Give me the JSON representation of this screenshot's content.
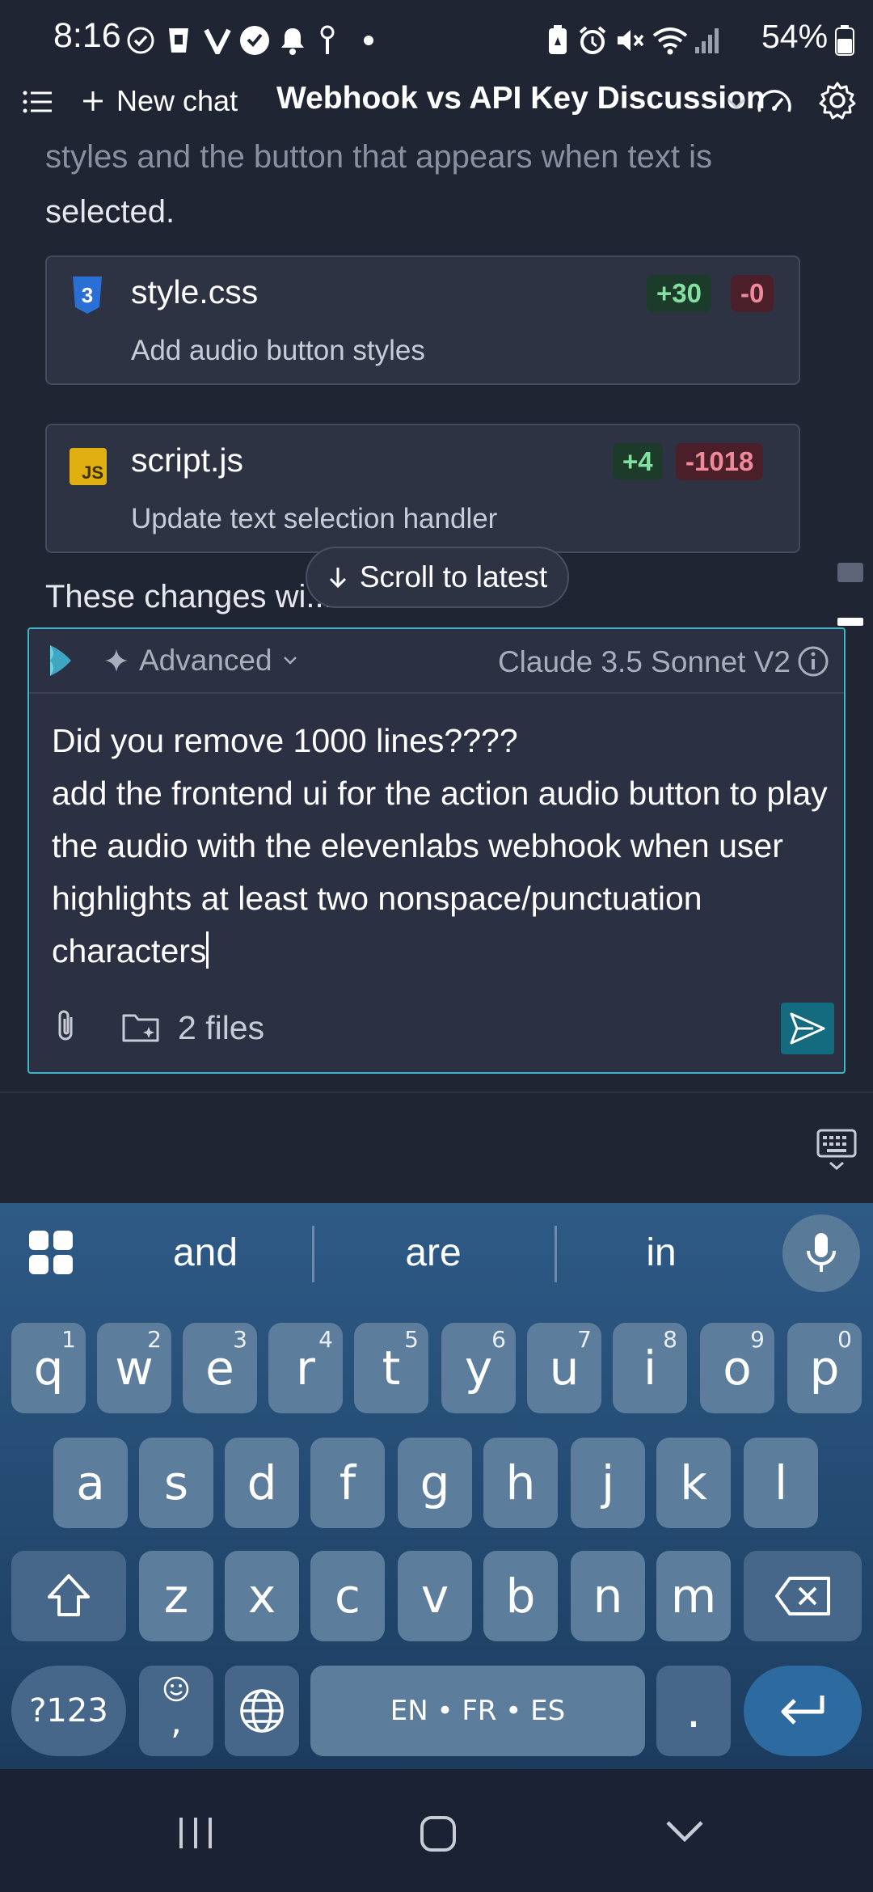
{
  "status_bar": {
    "time": "8:16",
    "battery": "54%"
  },
  "header": {
    "new_chat": "New chat",
    "title": "Webhook vs API Key Discussion"
  },
  "chat": {
    "prev_line_dim": "styles and the button that appears when text is",
    "prev_line": "selected.",
    "files": [
      {
        "name": "style.css",
        "desc": "Add audio button styles",
        "added": "+30",
        "removed": "-0",
        "icon": "css3-icon"
      },
      {
        "name": "script.js",
        "desc": "Update text selection handler",
        "added": "+4",
        "removed": "-1018",
        "icon": "js-icon"
      }
    ],
    "partial_text": "These changes wi...",
    "scroll_latest": "Scroll to latest"
  },
  "composer": {
    "mode": "Advanced",
    "model": "Claude 3.5 Sonnet V2",
    "message": "Did you remove 1000 lines????\nadd the frontend ui for the action audio button to play the audio with the elevenlabs webhook when user highlights at least two nonspace/punctuation characters",
    "files_label": "2 files"
  },
  "keyboard": {
    "suggestions": [
      "and",
      "are",
      "in"
    ],
    "row1": [
      {
        "k": "q",
        "n": "1"
      },
      {
        "k": "w",
        "n": "2"
      },
      {
        "k": "e",
        "n": "3"
      },
      {
        "k": "r",
        "n": "4"
      },
      {
        "k": "t",
        "n": "5"
      },
      {
        "k": "y",
        "n": "6"
      },
      {
        "k": "u",
        "n": "7"
      },
      {
        "k": "i",
        "n": "8"
      },
      {
        "k": "o",
        "n": "9"
      },
      {
        "k": "p",
        "n": "0"
      }
    ],
    "row2": [
      "a",
      "s",
      "d",
      "f",
      "g",
      "h",
      "j",
      "k",
      "l"
    ],
    "row3": [
      "z",
      "x",
      "c",
      "v",
      "b",
      "n",
      "m"
    ],
    "sym_key": "?123",
    "comma_key": ",",
    "space_label": "EN • FR • ES",
    "period_key": "."
  },
  "colors": {
    "accent": "#3fb5c7",
    "send": "#146b80",
    "background": "#202534"
  }
}
